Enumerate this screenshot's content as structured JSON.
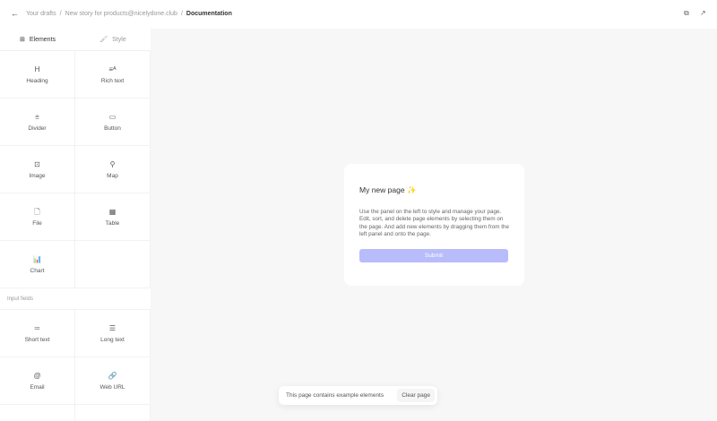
{
  "header": {
    "breadcrumbs": [
      "Your drafts",
      "New story for products@nicelydone.club"
    ],
    "current": "Documentation",
    "separator": "/"
  },
  "tabs": [
    {
      "label": "Elements",
      "icon": "grid-icon"
    },
    {
      "label": "Style",
      "icon": "brush-icon"
    }
  ],
  "elements": [
    {
      "label": "Heading",
      "icon": "H"
    },
    {
      "label": "Rich text",
      "icon": "≡ᴬ"
    },
    {
      "label": "Divider",
      "icon": "⩧"
    },
    {
      "label": "Button",
      "icon": "▭"
    },
    {
      "label": "Image",
      "icon": "⊡"
    },
    {
      "label": "Map",
      "icon": "⚲"
    },
    {
      "label": "File",
      "icon": "🗋"
    },
    {
      "label": "Table",
      "icon": "▦"
    },
    {
      "label": "Chart",
      "icon": "📊"
    }
  ],
  "input_section": "Input fields",
  "inputs": [
    {
      "label": "Short text",
      "icon": "═"
    },
    {
      "label": "Long text",
      "icon": "☰"
    },
    {
      "label": "Email",
      "icon": "@"
    },
    {
      "label": "Web URL",
      "icon": "🔗"
    }
  ],
  "card": {
    "title": "My new page",
    "sparkle": "✨",
    "body": "Use the panel on the left to style and manage your page. Edit, sort, and delete page elements by selecting them on the page. And add new elements by dragging them from the left panel and onto the page.",
    "submit": "Submit"
  },
  "toast": {
    "message": "This page contains example elements",
    "action": "Clear page"
  }
}
